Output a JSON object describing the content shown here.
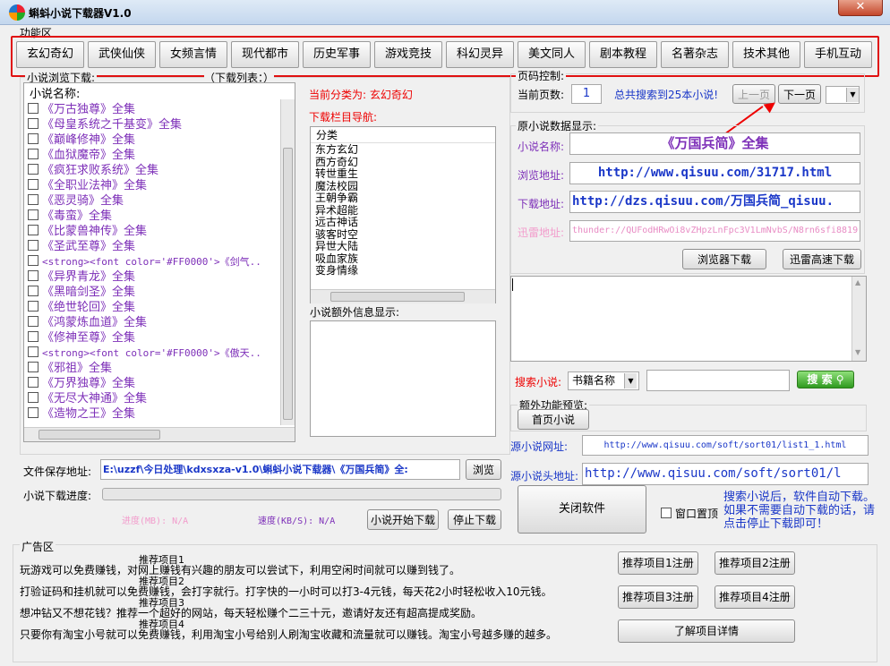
{
  "window": {
    "title": "蝌蚪小说下载器V1.0",
    "close": "✕"
  },
  "func_area": {
    "label": "功能区",
    "buttons": [
      "玄幻奇幻",
      "武侠仙侠",
      "女频言情",
      "现代都市",
      "历史军事",
      "游戏竞技",
      "科幻灵异",
      "美文同人",
      "剧本教程",
      "名著杂志",
      "技术其他",
      "手机互动"
    ]
  },
  "browse": {
    "label": "小说浏览下载:",
    "download_list": "（下载列表：）",
    "col_header": "小说名称:",
    "items": [
      "《万古独尊》全集",
      "《母皇系统之千基变》全集",
      "《巅峰修神》全集",
      "《血狱魔帝》全集",
      "《疯狂求败系统》全集",
      "《全职业法神》全集",
      "《恶灵骑》全集",
      "《毒蛮》全集",
      "《比蒙兽神传》全集",
      "《圣武至尊》全集",
      "<strong><font color='#FF0000'>《剑气..",
      "《异界青龙》全集",
      "《黑暗剑圣》全集",
      "《绝世轮回》全集",
      "《鸿蒙炼血道》全集",
      "《修神至尊》全集",
      "<strong><font color='#FF0000'>《傲天..",
      "《邪祖》全集",
      "《万界独尊》全集",
      "《无尽大神通》全集",
      "《造物之王》全集"
    ]
  },
  "category": {
    "current_label": "当前分类为:",
    "current_value": "玄幻奇幻",
    "nav_label": "下载栏目导航:",
    "header": "分类",
    "items": [
      "东方玄幻",
      "西方奇幻",
      "转世重生",
      "魔法校园",
      "王朝争霸",
      "异术超能",
      "远古神话",
      "骇客时空",
      "异世大陆",
      "吸血家族",
      "变身情缘"
    ],
    "extra_label": "小说额外信息显示:"
  },
  "page_ctrl": {
    "label": "页码控制:",
    "current_label": "当前页数:",
    "current_value": "1",
    "total": "总共搜索到25本小说!",
    "prev": "上一页",
    "next": "下一页"
  },
  "source": {
    "label": "原小说数据显示:",
    "name_label": "小说名称:",
    "name_value": "《万国兵简》全集",
    "browse_label": "浏览地址:",
    "browse_value": "http://www.qisuu.com/31717.html",
    "download_label": "下载地址:",
    "download_value": "http://dzs.qisuu.com/万国兵简_qisuu.",
    "thunder_label": "迅雷地址:",
    "thunder_value": "thunder://QUFodHRwOi8vZHpzLnFpc3V1LmNvbS/N8rn6sfi8819",
    "btn_browser": "浏览器下载",
    "btn_thunder": "迅雷高速下载"
  },
  "search": {
    "label": "搜索小说:",
    "select_value": "书籍名称",
    "input_value": "",
    "button": "搜 索"
  },
  "extra": {
    "label": "额外功能预览:",
    "home_btn": "首页小说",
    "src_url_label": "源小说网址:",
    "src_url_value": "http://www.qisuu.com/soft/sort01/list1_1.html",
    "src_head_label": "源小说头地址:",
    "src_head_value": "http://www.qisuu.com/soft/sort01/l"
  },
  "save": {
    "label": "文件保存地址:",
    "value": "E:\\uzzf\\今日处理\\kdxsxza-v1.0\\蝌蚪小说下载器\\《万国兵简》全:",
    "browse": "浏览"
  },
  "progress": {
    "label": "小说下载进度:",
    "fraction": 0,
    "progress_text": "进度(MB): N/A",
    "speed_text": "速度(KB/S): N/A",
    "start": "小说开始下载",
    "stop": "停止下载"
  },
  "close_btn": "关闭软件",
  "topmost": "窗口置顶",
  "hint": "搜索小说后，软件自动下载。如果不需要自动下载的话，请点击停止下载即可！",
  "ads": {
    "label": "广告区",
    "lines": [
      "玩游戏可以免费赚钱，对网上赚钱有兴趣的朋友可以尝试下，利用空闲时间就可以赚到钱了。",
      "打验证码和挂机就可以免费赚钱，会打字就行。打字快的一小时可以打3-4元钱，每天花2小时轻松收入10元钱。",
      "想冲钻又不想花钱？推荐一个超好的网站，每天轻松赚个二三十元，邀请好友还有超高提成奖励。",
      "只要你有淘宝小号就可以免费赚钱，利用淘宝小号给别人刷淘宝收藏和流量就可以赚钱。淘宝小号越多赚的越多。"
    ],
    "tags": [
      "推荐项目1",
      "推荐项目2",
      "推荐项目3",
      "推荐项目4"
    ],
    "reg": [
      "推荐项目1注册",
      "推荐项目2注册",
      "推荐项目3注册",
      "推荐项目4注册"
    ],
    "details": "了解项目详情"
  },
  "colors": {
    "red": "#e00000",
    "purple": "#7d2fb8",
    "blue": "#1a37c8"
  }
}
